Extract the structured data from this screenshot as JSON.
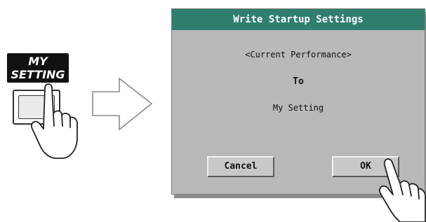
{
  "hardware": {
    "label_line1": "MY",
    "label_line2": "SETTING"
  },
  "dialog": {
    "title": "Write Startup Settings",
    "source": "<Current Performance>",
    "connector": "To",
    "destination": "My Setting",
    "cancel_label": "Cancel",
    "ok_label": "OK"
  },
  "colors": {
    "title_bar": "#2f7f6f",
    "dialog_bg": "#b9b9b9",
    "label_bg": "#111111"
  },
  "icons": [
    "pointing-hand-icon",
    "right-arrow-icon"
  ]
}
